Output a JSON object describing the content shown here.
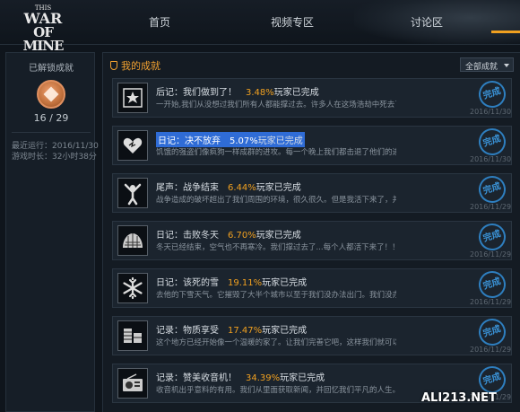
{
  "logo": {
    "line1": "THIS",
    "line2": "WAR",
    "line3": "OF MINE"
  },
  "nav": [
    {
      "label": "首页"
    },
    {
      "label": "视频专区"
    },
    {
      "label": "讨论区"
    }
  ],
  "sidebar": {
    "title": "已解锁成就",
    "progress": "16 / 29",
    "recent_run": "最近运行：2016/11/30",
    "playtime": "游戏时长：32小时38分"
  },
  "main": {
    "header": "我的成就",
    "filter": "全部成就"
  },
  "achievements": [
    {
      "title": "后记：我们做到了！",
      "percent": "3.48%",
      "done": "玩家已完成",
      "desc": "一开始,我们从没想过我们所有人都能撑过去。许多人在这场浩劫中死去了...",
      "stamp": "完成",
      "date": "2016/11/30",
      "icon": "star-frame-icon"
    },
    {
      "title": "日记：决不放弃",
      "percent": "5.07%",
      "done": "玩家已完成",
      "desc": "饥饿的强盗们像疯狗一样成群的进攻。每一个晚上我们都击退了他们的进...",
      "stamp": "完成",
      "date": "2016/11/30",
      "icon": "heart-icon"
    },
    {
      "title": "尾声：战争结束",
      "percent": "6.44%",
      "done": "玩家已完成",
      "desc": "战争造成的破坏超出了我们周围的环境，很久很久。但是我活下来了，并...",
      "stamp": "完成",
      "date": "2016/11/29",
      "icon": "raised-arms-icon"
    },
    {
      "title": "日记：击败冬天",
      "percent": "6.70%",
      "done": "玩家已完成",
      "desc": "冬天已经结束，空气也不再寒冷。我们撑过去了...每个人都活下来了！！...",
      "stamp": "完成",
      "date": "2016/11/29",
      "icon": "shelter-icon"
    },
    {
      "title": "日记：该死的雪",
      "percent": "19.11%",
      "done": "玩家已完成",
      "desc": "去他的下雪天气。它摧毁了大半个城市以至于我们没办法出门。我们没办...",
      "stamp": "完成",
      "date": "2016/11/29",
      "icon": "snowflake-icon"
    },
    {
      "title": "记录：物质享受",
      "percent": "17.47%",
      "done": "玩家已完成",
      "desc": "这个地方已经开始像一个温暖的家了。让我们完善它吧，这样我们就可以...",
      "stamp": "完成",
      "date": "2016/11/29",
      "icon": "furniture-icon"
    },
    {
      "title": "记录：赞美收音机！",
      "percent": "34.39%",
      "done": "玩家已完成",
      "desc": "收音机出乎意料的有用。我们从里面获取新闻，并回忆我们平凡的人生。",
      "stamp": "完成",
      "date": "2016/11/29",
      "icon": "radio-icon"
    }
  ],
  "watermark": "ALI213.NET"
}
